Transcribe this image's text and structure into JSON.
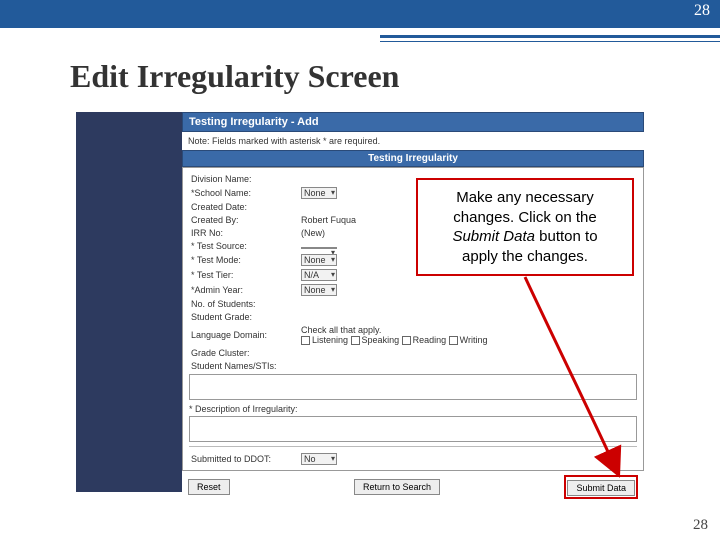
{
  "slide": {
    "page_top": "28",
    "page_bottom": "28",
    "title": "Edit Irregularity Screen"
  },
  "form": {
    "header": "Testing Irregularity - Add",
    "note": "Note: Fields marked with asterisk * are required.",
    "band": "Testing Irregularity",
    "labels": {
      "division": "Division Name:",
      "school": "*School Name:",
      "created_date": "Created Date:",
      "created_by": "Created By:",
      "irr_no": "IRR No:",
      "test_source": "* Test Source:",
      "test_mode": "* Test Mode:",
      "test_tier": "* Test Tier:",
      "admin_year": "*Admin Year:",
      "no_students": "No. of Students:",
      "student_grade": "Student Grade:",
      "lang_domain": "Language Domain:",
      "grade_cluster": "Grade Cluster:",
      "student_names": "Student Names/STIs:",
      "desc": "* Description of Irregularity:",
      "submitted": "Submitted to DDOT:"
    },
    "values": {
      "division": "",
      "school": "None",
      "created_date": "",
      "created_by": "Robert Fuqua",
      "irr_no": "(New)",
      "test_source": "",
      "test_mode": "None",
      "test_tier": "N/A",
      "admin_year": "None",
      "no_students": "",
      "student_grade": "",
      "grade_cluster": "",
      "submitted": "No",
      "check_hint": "Check all that apply.",
      "dom_listening": "Listening",
      "dom_speaking": "Speaking",
      "dom_reading": "Reading",
      "dom_writing": "Writing"
    },
    "buttons": {
      "reset": "Reset",
      "return": "Return to Search",
      "submit": "Submit Data"
    }
  },
  "callout": {
    "line1": "Make any necessary",
    "line2": "changes. Click on the",
    "line3a": "Submit Data",
    "line3b": " button to",
    "line4": "apply the changes."
  }
}
